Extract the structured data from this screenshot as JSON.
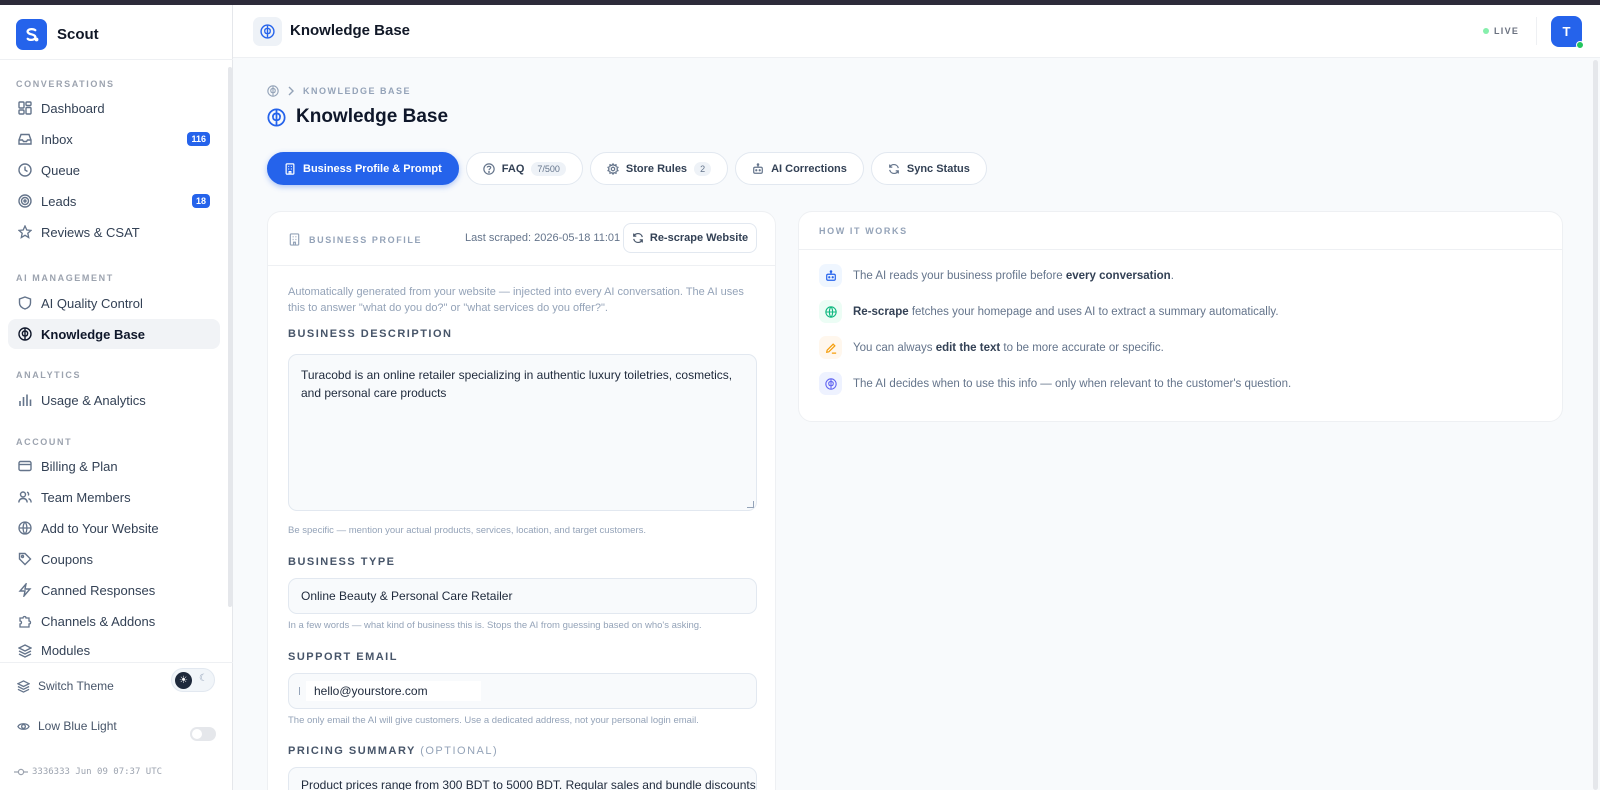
{
  "app": {
    "name": "Scout"
  },
  "colors": {
    "accent": "#2563eb",
    "live_dot": "#86efac",
    "online": "#22c55e"
  },
  "sidebar": {
    "sections": [
      {
        "label": "CONVERSATIONS"
      },
      {
        "label": "AI MANAGEMENT"
      },
      {
        "label": "ANALYTICS"
      },
      {
        "label": "ACCOUNT"
      }
    ],
    "items": [
      {
        "label": "Dashboard",
        "icon": "dashboard-icon"
      },
      {
        "label": "Inbox",
        "icon": "inbox-icon",
        "badge": "116"
      },
      {
        "label": "Queue",
        "icon": "clock-icon"
      },
      {
        "label": "Leads",
        "icon": "target-icon",
        "badge": "18"
      },
      {
        "label": "Reviews & CSAT",
        "icon": "star-icon"
      },
      {
        "label": "AI Quality Control",
        "icon": "shield-icon"
      },
      {
        "label": "Knowledge Base",
        "icon": "brain-icon",
        "active": true
      },
      {
        "label": "Usage & Analytics",
        "icon": "bar-chart-icon"
      },
      {
        "label": "Billing & Plan",
        "icon": "credit-card-icon"
      },
      {
        "label": "Team Members",
        "icon": "users-icon"
      },
      {
        "label": "Add to Your Website",
        "icon": "globe-icon"
      },
      {
        "label": "Coupons",
        "icon": "tag-icon"
      },
      {
        "label": "Canned Responses",
        "icon": "zap-icon"
      },
      {
        "label": "Channels & Addons",
        "icon": "puzzle-icon"
      },
      {
        "label": "Modules",
        "icon": "layers-icon"
      }
    ],
    "switch_theme": "Switch Theme",
    "low_blue_light": "Low Blue Light",
    "build_info": "3336333 Jun 09 07:37 UTC"
  },
  "header": {
    "title": "Knowledge Base",
    "status": "LIVE",
    "avatar_initial": "T"
  },
  "breadcrumb": {
    "current": "KNOWLEDGE BASE"
  },
  "page": {
    "title": "Knowledge Base"
  },
  "tabs": [
    {
      "label": "Business Profile & Prompt",
      "active": true
    },
    {
      "label": "FAQ",
      "count": "7/500"
    },
    {
      "label": "Store Rules",
      "count": "2"
    },
    {
      "label": "AI Corrections"
    },
    {
      "label": "Sync Status"
    }
  ],
  "business_profile": {
    "section_label": "BUSINESS PROFILE",
    "last_scraped": "Last scraped: 2026-05-18 11:01",
    "rescrape_label": "Re-scrape Website",
    "intro": "Automatically generated from your website — injected into every AI conversation. The AI uses this to answer \"what do you do?\" or \"what services do you offer?\".",
    "description": {
      "label": "BUSINESS DESCRIPTION",
      "value": "Turacobd is an online retailer specializing in authentic luxury toiletries, cosmetics, and personal care products",
      "hint": "Be specific — mention your actual products, services, location, and target customers."
    },
    "type": {
      "label": "BUSINESS TYPE",
      "value": "Online Beauty & Personal Care Retailer",
      "hint": "In a few words — what kind of business this is. Stops the AI from guessing based on who's asking."
    },
    "email": {
      "label": "SUPPORT EMAIL",
      "value": "hello@yourstore.com",
      "hint": "The only email the AI will give customers. Use a dedicated address, not your personal login email."
    },
    "pricing": {
      "label": "PRICING SUMMARY",
      "optional": "(OPTIONAL)",
      "value": "Product prices range from 300 BDT to 5000 BDT. Regular sales and bundle discounts a"
    }
  },
  "how_it_works": {
    "label": "HOW IT WORKS",
    "rows": [
      {
        "pre": "The AI reads your business profile before ",
        "bold": "every conversation",
        "post": ".",
        "icon": "bot-icon"
      },
      {
        "pre": "",
        "bold": "Re-scrape",
        "post": " fetches your homepage and uses AI to extract a summary automatically.",
        "icon": "globe-icon"
      },
      {
        "pre": "You can always ",
        "bold": "edit the text",
        "post": " to be more accurate or specific.",
        "icon": "pencil-icon"
      },
      {
        "pre": "The AI decides when to use this info — only when relevant to the customer's question.",
        "bold": "",
        "post": "",
        "icon": "brain-icon"
      }
    ]
  }
}
